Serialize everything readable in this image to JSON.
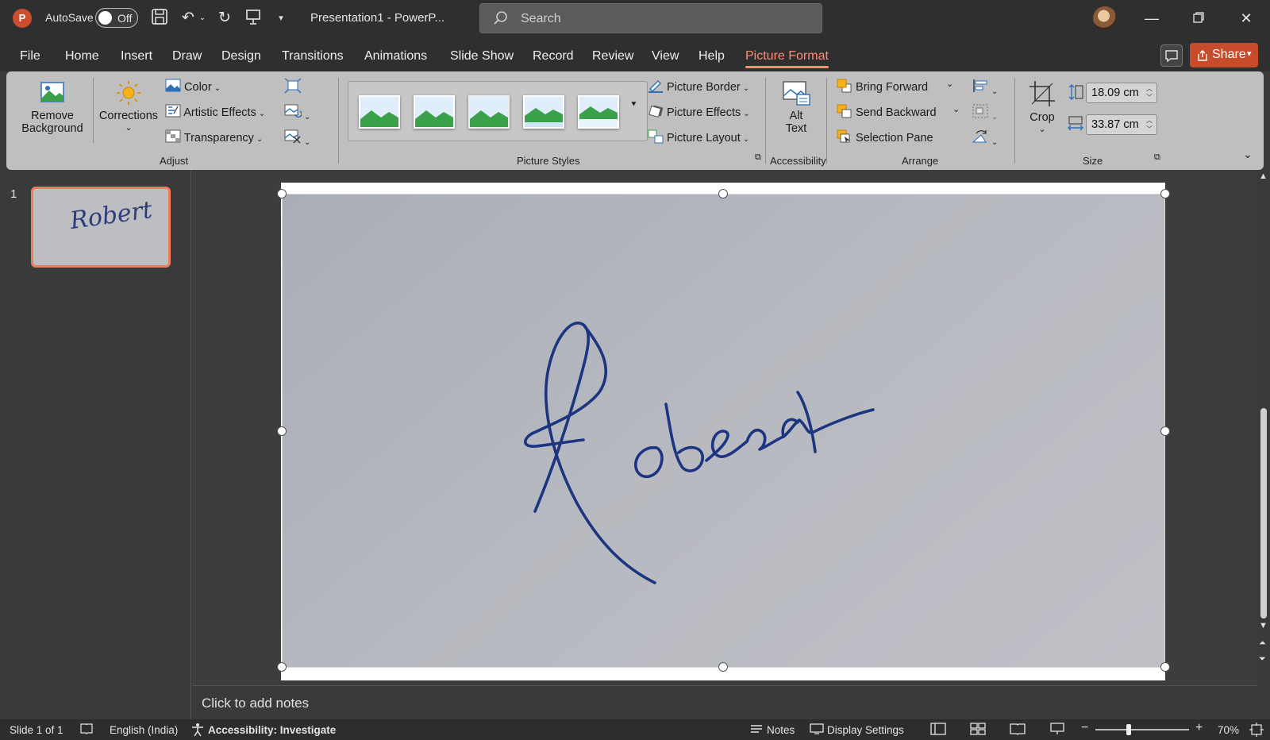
{
  "app": {
    "logo": "P",
    "autosave_label": "AutoSave",
    "autosave_state": "Off",
    "document_title": "Presentation1  -  PowerP...",
    "search_placeholder": "Search"
  },
  "menu": {
    "tabs": [
      "File",
      "Home",
      "Insert",
      "Draw",
      "Design",
      "Transitions",
      "Animations",
      "Slide Show",
      "Record",
      "Review",
      "View",
      "Help",
      "Picture Format"
    ],
    "active_tab": "Picture Format",
    "share_label": "Share"
  },
  "ribbon": {
    "remove_background": [
      "Remove",
      "Background"
    ],
    "corrections": "Corrections",
    "color": "Color",
    "artistic_effects": "Artistic Effects",
    "transparency": "Transparency",
    "adjust_label": "Adjust",
    "picture_styles_label": "Picture Styles",
    "picture_border": "Picture Border",
    "picture_effects": "Picture Effects",
    "picture_layout": "Picture Layout",
    "alt_text": [
      "Alt",
      "Text"
    ],
    "accessibility_label": "Accessibility",
    "bring_forward": "Bring Forward",
    "send_backward": "Send Backward",
    "selection_pane": "Selection Pane",
    "arrange_label": "Arrange",
    "crop": "Crop",
    "height_value": "18.09 cm",
    "width_value": "33.87 cm",
    "size_label": "Size"
  },
  "slides": {
    "thumb_number": "1",
    "thumb_signature": "Robert",
    "signature_text": "Robert"
  },
  "notes": {
    "placeholder": "Click to add notes"
  },
  "status": {
    "slide_info": "Slide 1 of 1",
    "language": "English (India)",
    "accessibility": "Accessibility: Investigate",
    "notes": "Notes",
    "display_settings": "Display Settings",
    "zoom": "70%"
  },
  "colors": {
    "accent": "#ff8a73",
    "share_button": "#c64c2b",
    "ink": "#1d3580"
  }
}
